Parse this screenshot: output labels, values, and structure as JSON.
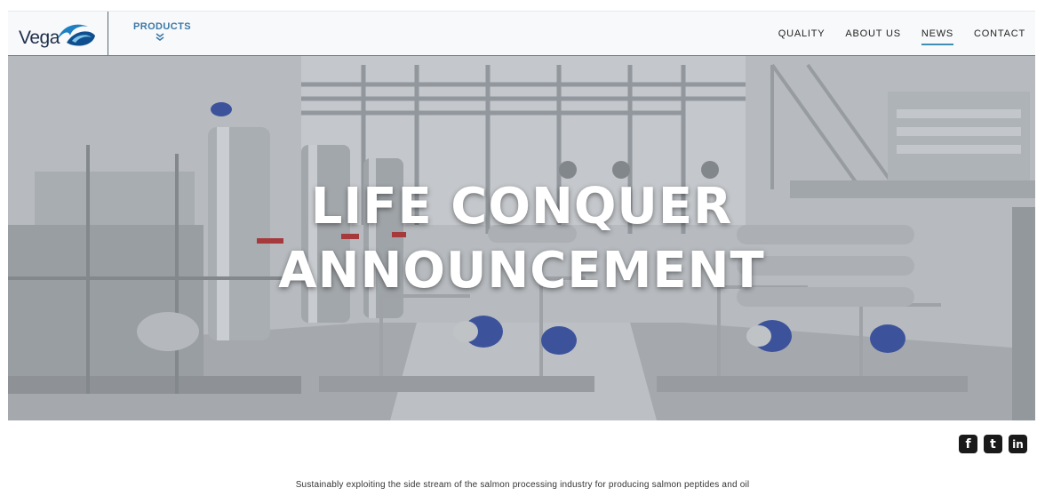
{
  "header": {
    "logo_text": "Vega",
    "products_label": "PRODUCTS",
    "nav": [
      {
        "label": "QUALITY",
        "active": false
      },
      {
        "label": "ABOUT US",
        "active": false
      },
      {
        "label": "NEWS",
        "active": true
      },
      {
        "label": "CONTACT",
        "active": false
      }
    ]
  },
  "hero": {
    "title_line1": "LIFE CONQUER",
    "title_line2": "ANNOUNCEMENT"
  },
  "social": [
    {
      "name": "facebook-icon",
      "glyph": "f"
    },
    {
      "name": "twitter-icon",
      "glyph": "t"
    },
    {
      "name": "linkedin-icon",
      "glyph": "in"
    }
  ],
  "tagline": "Sustainably exploiting the side stream of the salmon processing industry for producing salmon peptides and oil",
  "colors": {
    "accent": "#3f8fb5",
    "nav_text": "#222222",
    "products": "#3b79a7"
  }
}
